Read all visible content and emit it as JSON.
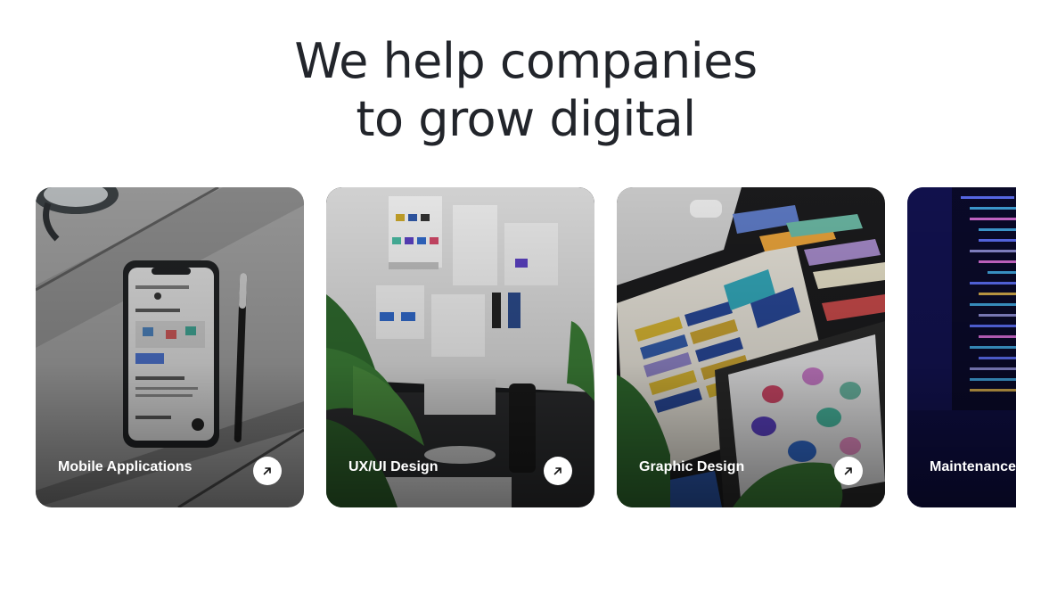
{
  "hero": {
    "title_line1": "We help companies",
    "title_line2": "to grow digital"
  },
  "services": [
    {
      "label": "Mobile Applications",
      "icon": "arrow-up-right-icon"
    },
    {
      "label": "UX/UI Design",
      "icon": "arrow-up-right-icon"
    },
    {
      "label": "Graphic Design",
      "icon": "arrow-up-right-icon"
    },
    {
      "label": "Maintenance",
      "icon": "arrow-up-right-icon"
    }
  ],
  "colors": {
    "heading": "#22252b",
    "card_label": "#ffffff",
    "arrow_button": "#ffffff"
  }
}
